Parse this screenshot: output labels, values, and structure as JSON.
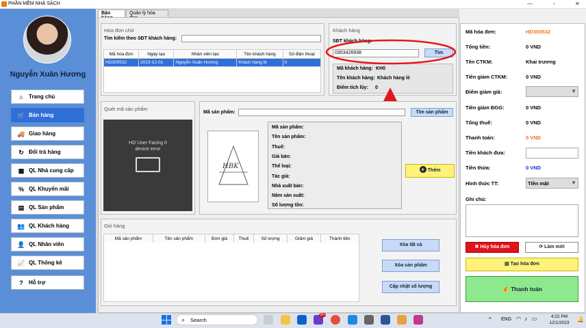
{
  "window": {
    "title": "PHẦN MỀM NHÀ SÁCH"
  },
  "user": {
    "name": "Nguyễn Xuân Hương"
  },
  "nav": [
    {
      "label": "Trang chủ",
      "icon": "home-icon",
      "glyph": "⌂"
    },
    {
      "label": "Bán hàng",
      "icon": "cart-icon",
      "glyph": "🛒"
    },
    {
      "label": "Giao hàng",
      "icon": "truck-icon",
      "glyph": "🚚"
    },
    {
      "label": "Đổi trả hàng",
      "icon": "return-icon",
      "glyph": "↻"
    },
    {
      "label": "QL Nhà cung cấp",
      "icon": "supplier-icon",
      "glyph": "▦"
    },
    {
      "label": "QL Khuyến mãi",
      "icon": "sale-icon",
      "glyph": "%"
    },
    {
      "label": "QL Sản phẩm",
      "icon": "product-icon",
      "glyph": "▤"
    },
    {
      "label": "QL Khách hàng",
      "icon": "customer-icon",
      "glyph": "👥"
    },
    {
      "label": "QL Nhân viên",
      "icon": "employee-icon",
      "glyph": "👤"
    },
    {
      "label": "QL Thống kê",
      "icon": "chart-icon",
      "glyph": "📈"
    },
    {
      "label": "Hỗ trợ",
      "icon": "help-icon",
      "glyph": "?"
    }
  ],
  "tabs": [
    "Bán hàng",
    "Quản lý hóa đơn"
  ],
  "pending": {
    "title": "Hóa đơn chờ",
    "search_label": "Tìm kiếm theo SĐT khách hàng:",
    "columns": [
      "Mã hóa đơn",
      "Ngày tạo",
      "Nhân viên tạo",
      "Tên khách hàng",
      "Số điện thoại"
    ],
    "rows": [
      [
        "HD300532",
        "2023-12-01",
        "Nguyễn Xuân Hương",
        "Khách hàng lẻ",
        "0"
      ]
    ]
  },
  "customer": {
    "title": "Khách hàng",
    "phone_label": "SĐT khách hàng:",
    "phone_value": "0353426938",
    "search_btn": "Tìm",
    "code_label": "Mã khách hàng:",
    "code_value": "KH0",
    "name_label": "Tên khách hàng:",
    "name_value": "Khách hàng lẻ",
    "points_label": "Điểm tích lũy:",
    "points_value": "0"
  },
  "scan": {
    "title": "Quét mã sản phẩm",
    "camera_line1": "HD User Facing 0",
    "camera_line2": "device error"
  },
  "product": {
    "code_label": "Mã sản phẩm:",
    "find_btn": "Tìm sản phẩm",
    "fields": [
      "Mã sản phẩm:",
      "Tên sản phẩm:",
      "Thuế:",
      "Giá bán:",
      "Thể loại:",
      "Tác giả:",
      "Nhà xuất bản:",
      "Năm sản xuất:",
      "Số lượng tồn:"
    ],
    "add_btn": "Thêm",
    "logo_text": "HBK"
  },
  "cart": {
    "title": "Giỏ hàng",
    "columns": [
      "Mã sản phẩm",
      "Tên sản phẩm",
      "Đơn giá",
      "Thuế",
      "Số lượng",
      "Giảm giá",
      "Thành tiền"
    ],
    "btn_clear": "Xóa tất cả",
    "btn_remove": "Xóa sản phẩm",
    "btn_update": "Cập nhật số lượng"
  },
  "invoice": {
    "code_label": "Mã hóa đơn:",
    "code_value": "HD300532",
    "total_label": "Tổng tiền:",
    "total_value": "0 VND",
    "promo_label": "Tên CTKM:",
    "promo_value": "Khai trương",
    "promo_disc_label": "Tiền giảm CTKM:",
    "promo_disc_value": "0 VND",
    "points_label": "Điểm giảm giá:",
    "dgg_label": "Tiền giảm ĐGG:",
    "dgg_value": "0 VND",
    "tax_label": "Tổng thuế:",
    "tax_value": "0 VND",
    "pay_label": "Thanh toán:",
    "pay_value": "0 VND",
    "given_label": "Tiền khách đưa:",
    "change_label": "Tiền thừa:",
    "change_value": "0 VND",
    "method_label": "Hình thức TT:",
    "method_value": "Tiền mặt",
    "note_label": "Ghi chú:",
    "btn_cancel": "Hủy hóa đơn",
    "btn_refresh": "Làm mới",
    "btn_new": "Tạo hóa đơn",
    "btn_pay": "Thanh toán"
  },
  "colors": {
    "sidebar": "#5a8fd8",
    "active": "#2f6fd8",
    "orange": "#f07020",
    "blue": "#1030d0",
    "red": "#e0141a",
    "annot_red": "#e3151b"
  },
  "taskbar": {
    "search": "Search",
    "lang": "ENG",
    "time": "4:22 PM",
    "date": "12/1/2023",
    "badge": "99+"
  }
}
